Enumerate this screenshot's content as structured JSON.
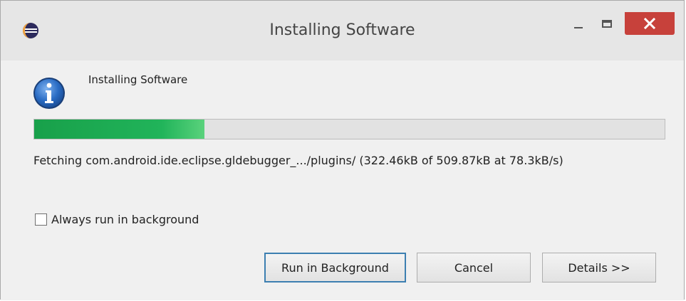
{
  "window": {
    "title": "Installing Software"
  },
  "dialog": {
    "message": "Installing Software",
    "progress_fraction": 0.27,
    "status_text": "Fetching com.android.ide.eclipse.gldebugger_.../plugins/ (322.46kB of 509.87kB at 78.3kB/s)",
    "always_background_label": "Always run in background",
    "always_background_checked": false
  },
  "buttons": {
    "run_in_background": "Run in Background",
    "cancel": "Cancel",
    "details": "Details >>"
  },
  "icons": {
    "app": "eclipse-icon",
    "info": "info-icon",
    "minimize": "minimize-icon",
    "maximize": "maximize-icon",
    "close": "close-icon"
  },
  "colors": {
    "progress": "#21b45a",
    "close_button": "#c7413b",
    "info_icon": "#1f63b8"
  }
}
